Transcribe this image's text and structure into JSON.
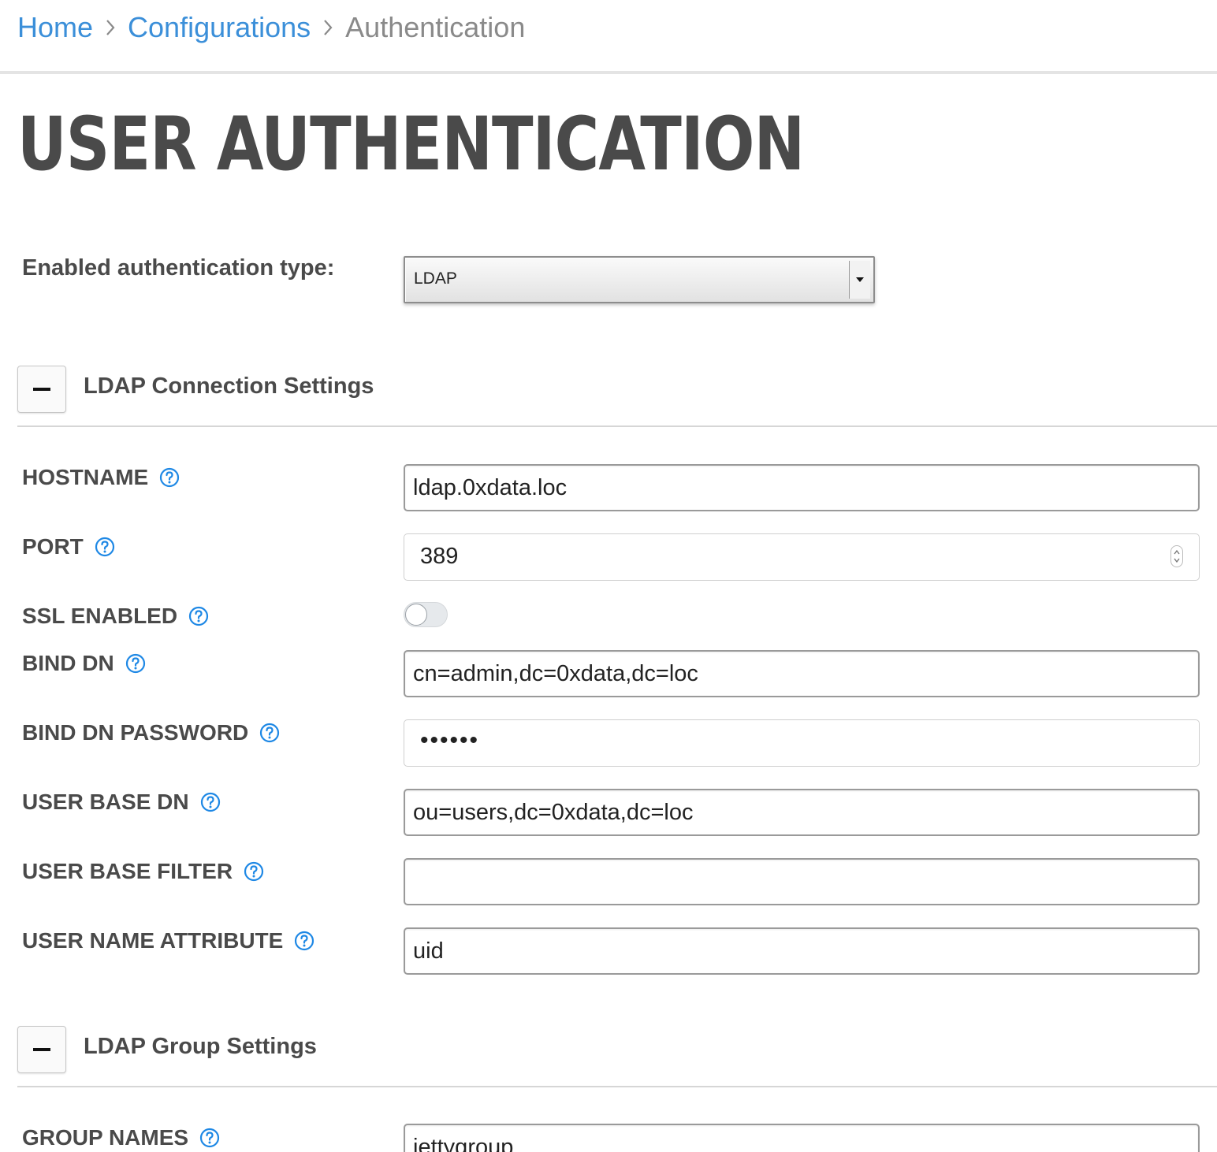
{
  "breadcrumb": {
    "items": [
      {
        "label": "Home"
      },
      {
        "label": "Configurations"
      },
      {
        "label": "Authentication"
      }
    ]
  },
  "page_title": "USER AUTHENTICATION",
  "auth_type": {
    "label": "Enabled authentication type:",
    "selected": "LDAP"
  },
  "sections": {
    "connection": {
      "title": "LDAP Connection Settings",
      "fields": {
        "hostname": {
          "label": "HOSTNAME",
          "value": "ldap.0xdata.loc"
        },
        "port": {
          "label": "PORT",
          "value": "389"
        },
        "ssl_enabled": {
          "label": "SSL ENABLED",
          "enabled": false
        },
        "bind_dn": {
          "label": "BIND DN",
          "value": "cn=admin,dc=0xdata,dc=loc"
        },
        "bind_dn_password": {
          "label": "BIND DN PASSWORD",
          "masked_value": "••••••"
        },
        "user_base_dn": {
          "label": "USER BASE DN",
          "value": "ou=users,dc=0xdata,dc=loc"
        },
        "user_base_filter": {
          "label": "USER BASE FILTER",
          "value": ""
        },
        "user_name_attribute": {
          "label": "USER NAME ATTRIBUTE",
          "value": "uid"
        }
      }
    },
    "group": {
      "title": "LDAP Group Settings",
      "fields": {
        "group_names": {
          "label": "GROUP NAMES",
          "value": "jettygroup"
        }
      }
    }
  },
  "icons": {
    "breadcrumb_separator": "chevron-right-icon",
    "help": "question-circle-icon",
    "collapse": "minus-icon",
    "select_arrow": "caret-down-icon"
  },
  "colors": {
    "link": "#3b8fd9",
    "help_icon": "#1e88e5",
    "heading": "#4a4a4a"
  }
}
